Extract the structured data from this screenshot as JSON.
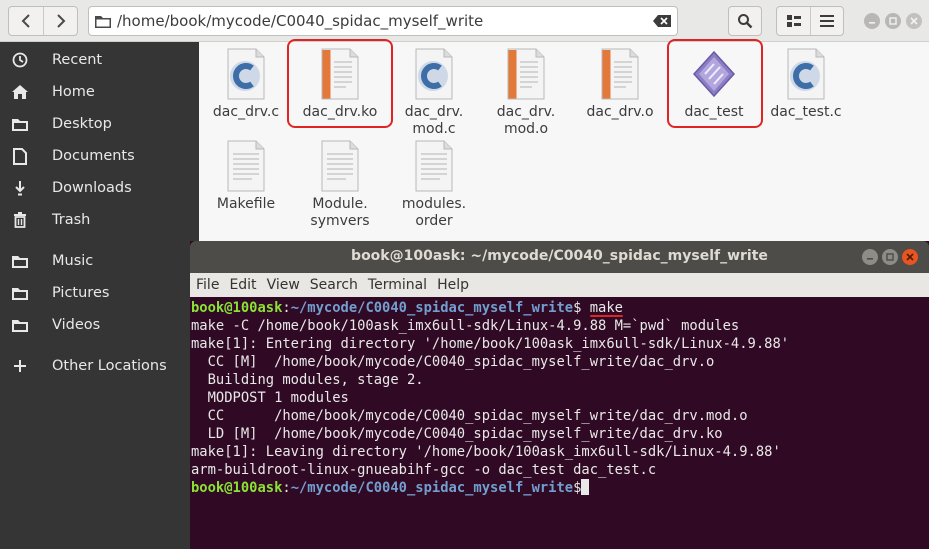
{
  "path_bar": {
    "path": "/home/book/mycode/C0040_spidac_myself_write"
  },
  "sidebar": {
    "items": [
      {
        "label": "Recent",
        "icon": "clock-icon"
      },
      {
        "label": "Home",
        "icon": "home-icon"
      },
      {
        "label": "Desktop",
        "icon": "folder-icon"
      },
      {
        "label": "Documents",
        "icon": "document-icon"
      },
      {
        "label": "Downloads",
        "icon": "download-icon"
      },
      {
        "label": "Trash",
        "icon": "trash-icon"
      },
      {
        "label": "Music",
        "icon": "folder-icon"
      },
      {
        "label": "Pictures",
        "icon": "folder-icon"
      },
      {
        "label": "Videos",
        "icon": "folder-icon"
      },
      {
        "label": "Other Locations",
        "icon": "plus-icon"
      }
    ]
  },
  "files": [
    {
      "name": "dac_drv.c",
      "type": "c-source"
    },
    {
      "name": "dac_drv.ko",
      "type": "binary",
      "highlighted": true
    },
    {
      "name": "dac_drv.\nmod.c",
      "type": "c-source"
    },
    {
      "name": "dac_drv.\nmod.o",
      "type": "binary"
    },
    {
      "name": "dac_drv.o",
      "type": "binary"
    },
    {
      "name": "dac_test",
      "type": "executable",
      "highlighted": true
    },
    {
      "name": "dac_test.c",
      "type": "c-source"
    },
    {
      "name": "Makefile",
      "type": "text"
    },
    {
      "name": "Module.\nsymvers",
      "type": "text"
    },
    {
      "name": "modules.\norder",
      "type": "text"
    }
  ],
  "terminal": {
    "title": "book@100ask: ~/mycode/C0040_spidac_myself_write",
    "menu": [
      "File",
      "Edit",
      "View",
      "Search",
      "Terminal",
      "Help"
    ],
    "prompt_user": "book@100ask",
    "prompt_path": "~/mycode/C0040_spidac_myself_write",
    "command": "make",
    "output": [
      "make -C /home/book/100ask_imx6ull-sdk/Linux-4.9.88 M=`pwd` modules",
      "make[1]: Entering directory '/home/book/100ask_imx6ull-sdk/Linux-4.9.88'",
      "  CC [M]  /home/book/mycode/C0040_spidac_myself_write/dac_drv.o",
      "  Building modules, stage 2.",
      "  MODPOST 1 modules",
      "  CC      /home/book/mycode/C0040_spidac_myself_write/dac_drv.mod.o",
      "  LD [M]  /home/book/mycode/C0040_spidac_myself_write/dac_drv.ko",
      "make[1]: Leaving directory '/home/book/100ask_imx6ull-sdk/Linux-4.9.88'",
      "arm-buildroot-linux-gnueabihf-gcc -o dac_test dac_test.c"
    ]
  },
  "colors": {
    "sidebar_bg": "#353535",
    "terminal_bg": "#300a24",
    "prompt_user": "#8ae234",
    "prompt_path": "#729fcf",
    "annotation_red": "#e02424",
    "close_button": "#e95420"
  }
}
